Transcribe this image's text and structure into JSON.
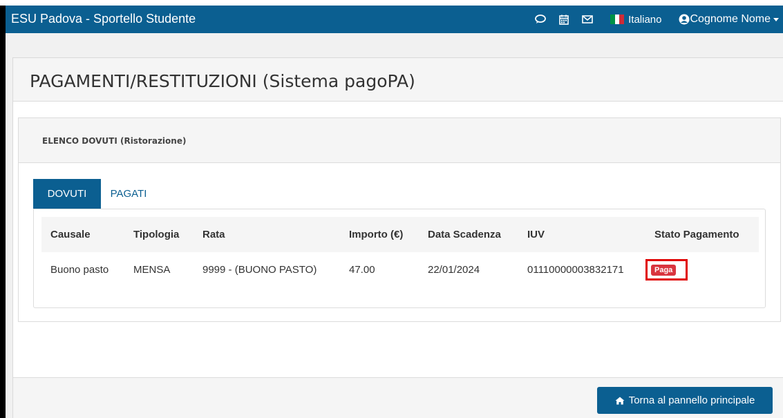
{
  "navbar": {
    "brand": "ESU Padova - Sportello Studente",
    "icons": [
      "chat-icon",
      "calendar-icon",
      "envelope-icon"
    ],
    "language": "Italiano",
    "user": "Cognome Nome"
  },
  "page": {
    "title": "PAGAMENTI/RESTITUZIONI (Sistema pagoPA)"
  },
  "section": {
    "title": "ELENCO DOVUTI (Ristorazione)",
    "tabs": [
      {
        "label": "DOVUTI",
        "active": true
      },
      {
        "label": "PAGATI",
        "active": false
      }
    ]
  },
  "table": {
    "headers": [
      "Causale",
      "Tipologia",
      "Rata",
      "Importo (€)",
      "Data Scadenza",
      "IUV",
      "Stato Pagamento"
    ],
    "rows": [
      {
        "causale": "Buono pasto",
        "tipologia": "MENSA",
        "rata": "9999 - (BUONO PASTO)",
        "importo": "47.00",
        "scadenza": "22/01/2024",
        "iuv": "01110000003832171",
        "stato_button": "Paga"
      }
    ]
  },
  "footer": {
    "back_label": "Torna al pannello principale"
  },
  "colors": {
    "primary": "#0b5f91",
    "danger": "#d9353f",
    "highlight": "#e00000"
  }
}
